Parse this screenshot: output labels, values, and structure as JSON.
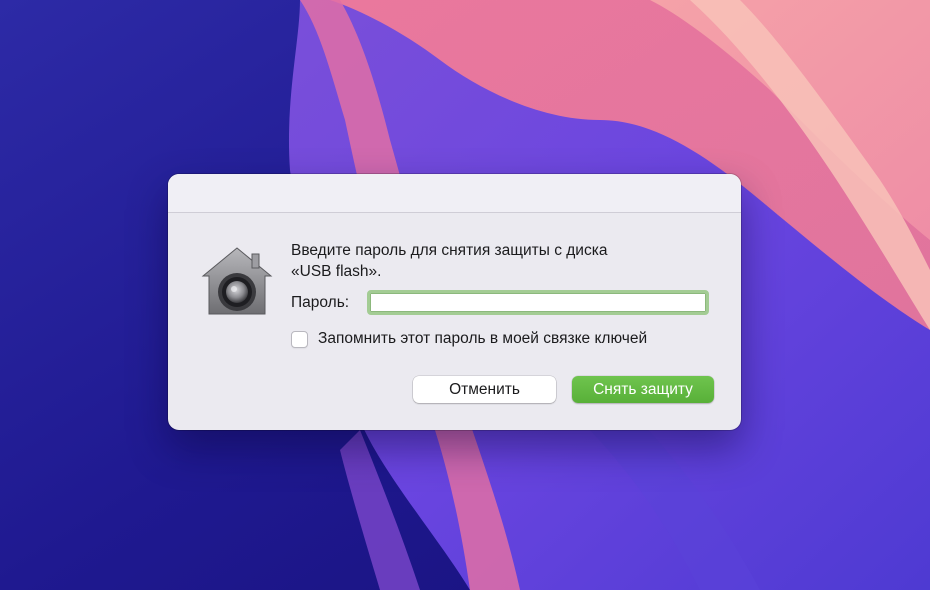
{
  "dialog": {
    "prompt_line1": "Введите пароль для снятия защиты с диска",
    "prompt_line2": "«USB flash».",
    "password_label": "Пароль:",
    "password_value": "",
    "password_placeholder": "",
    "remember_label": "Запомнить этот пароль в моей связке ключей",
    "remember_checked": false,
    "cancel_label": "Отменить",
    "unlock_label": "Снять защиту",
    "icon": "gatekeeper-lock-house-icon"
  },
  "colors": {
    "accent_green": "#5fb83f",
    "focus_ring": "#a3cc94",
    "dialog_bg": "#ebeaf0"
  }
}
